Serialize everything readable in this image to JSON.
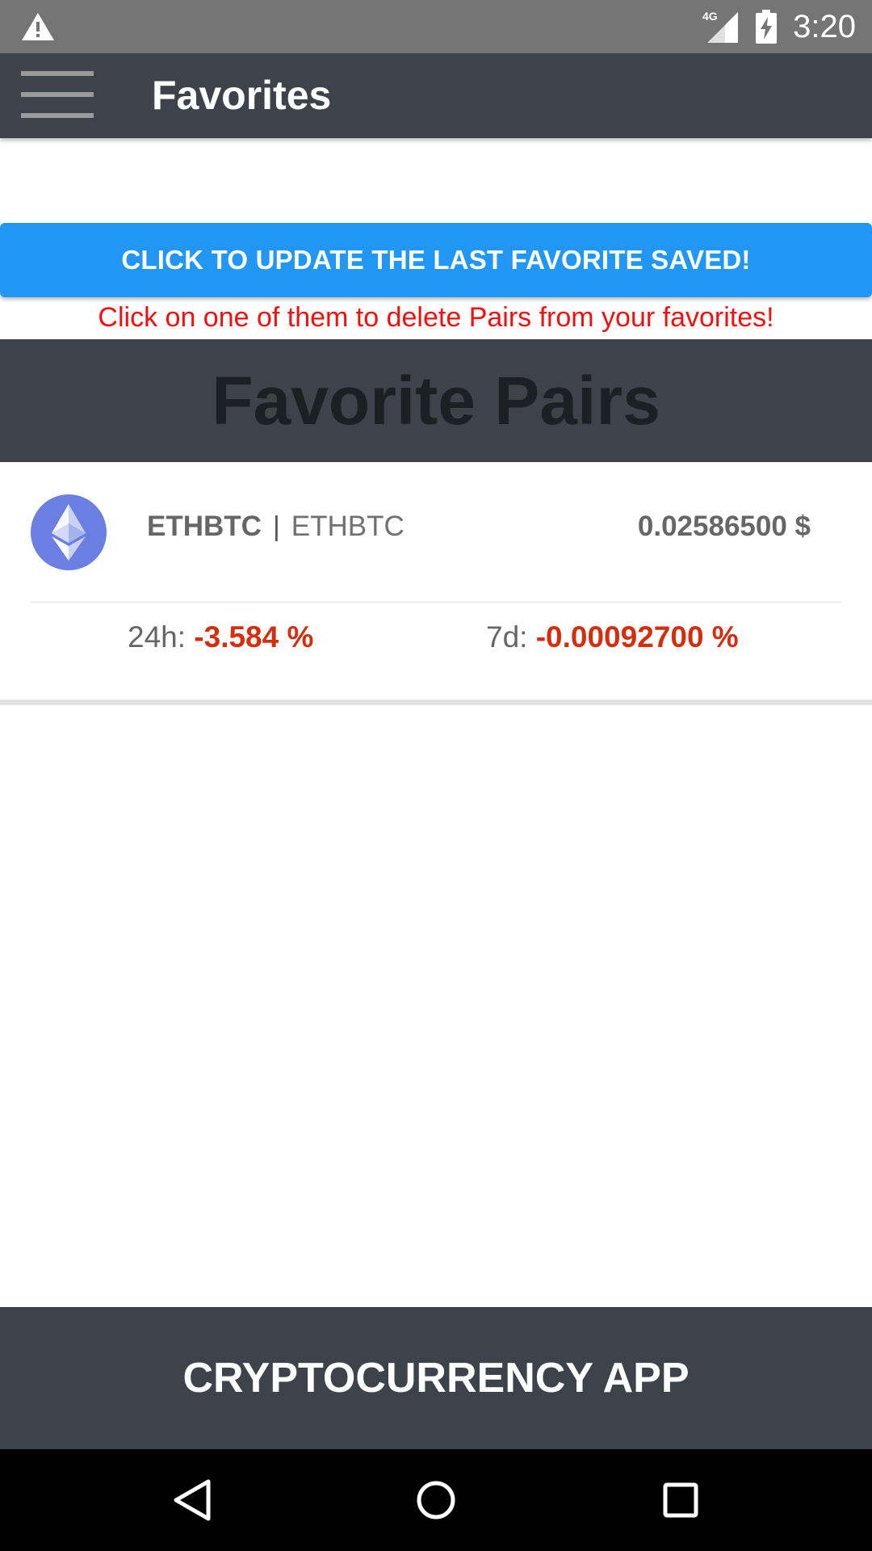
{
  "status_bar": {
    "network": "4G",
    "time": "3:20",
    "icons": [
      "warning-icon",
      "signal-icon",
      "battery-charging-icon"
    ]
  },
  "app_bar": {
    "title": "Favorites",
    "menu_icon": "hamburger-menu-icon"
  },
  "update_button": {
    "label": "CLICK TO UPDATE THE LAST FAVORITE SAVED!",
    "color": "#2196f3"
  },
  "delete_hint": "Click on one of them to delete Pairs from your favorites!",
  "section_header": "Favorite Pairs",
  "pairs": [
    {
      "icon": "ethereum-icon",
      "symbol": "ETHBTC",
      "separator": "|",
      "alt_symbol": "ETHBTC",
      "price": "0.02586500 $",
      "change_24h_label": "24h:",
      "change_24h_value": "-3.584 %",
      "change_7d_label": "7d:",
      "change_7d_value": "-0.00092700 %"
    }
  ],
  "footer": {
    "title": "CRYPTOCURRENCY APP"
  },
  "nav_bar": {
    "icons": [
      "back-icon",
      "home-icon",
      "recents-icon"
    ]
  },
  "colors": {
    "app_bar": "#3e434b",
    "status_bar": "#757575",
    "negative_change": "#d32f0f",
    "hint_text": "#f01010",
    "eth_logo": "#6b7fe3"
  }
}
